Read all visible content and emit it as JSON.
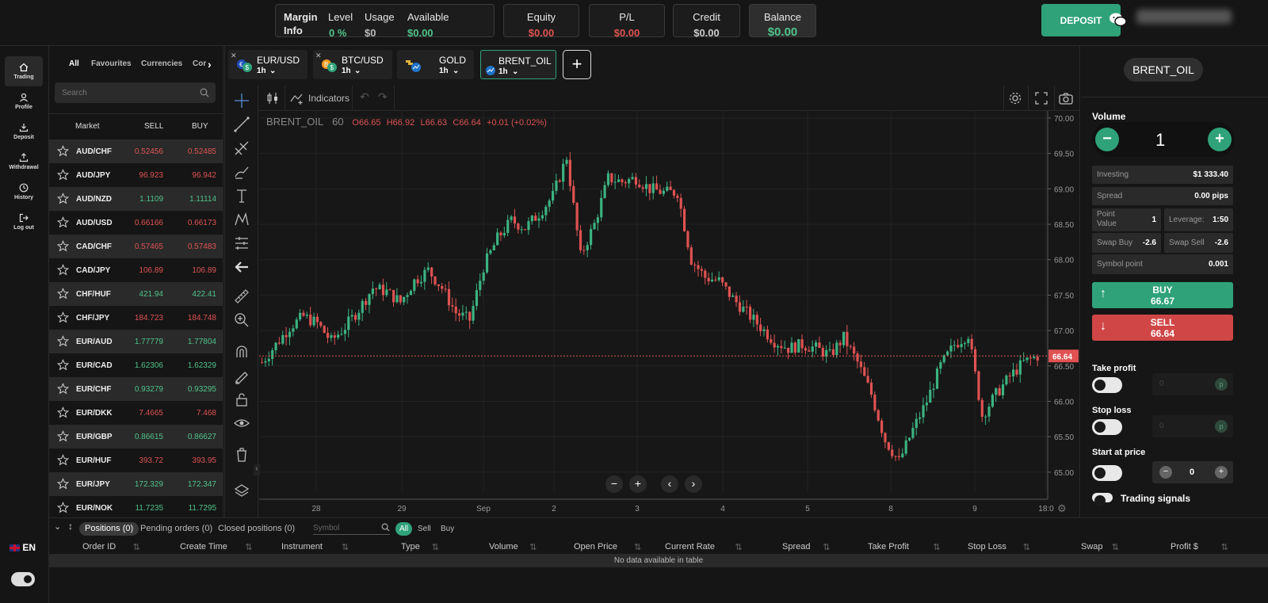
{
  "header": {
    "margin_info": {
      "title1": "Margin",
      "title2": "Info",
      "level_label": "Level",
      "level_value": "0  %",
      "usage_label": "Usage",
      "usage_value": "$0",
      "available_label": "Available",
      "available_value": "$0.00"
    },
    "metrics": [
      {
        "label": "Equity",
        "value": "$0.00",
        "color": "#e05252"
      },
      {
        "label": "P/L",
        "value": "$0.00",
        "color": "#e05252"
      },
      {
        "label": "Credit",
        "value": "$0.00",
        "color": "#cccccc"
      },
      {
        "label": "Balance",
        "value": "$0.00",
        "color": "#4fc28b"
      }
    ],
    "deposit_label": "DEPOSIT"
  },
  "rail": {
    "items": [
      {
        "label": "Trading",
        "icon": "home-icon"
      },
      {
        "label": "Profile",
        "icon": "user-icon"
      },
      {
        "label": "Deposit",
        "icon": "download-icon"
      },
      {
        "label": "Withdrawal",
        "icon": "upload-icon"
      },
      {
        "label": "History",
        "icon": "clock-icon"
      },
      {
        "label": "Log out",
        "icon": "logout-icon"
      }
    ],
    "language": "EN"
  },
  "market": {
    "tabs": [
      "All",
      "Favourites",
      "Currencies",
      "Cor"
    ],
    "search_placeholder": "Search",
    "col_market": "Market",
    "col_sell": "SELL",
    "col_buy": "BUY",
    "rows": [
      {
        "sym": "AUD/CHF",
        "sell": "0.52456",
        "buy": "0.52485",
        "c": "red"
      },
      {
        "sym": "AUD/JPY",
        "sell": "96.923",
        "buy": "96.942",
        "c": "red"
      },
      {
        "sym": "AUD/NZD",
        "sell": "1.1109",
        "buy": "1.11114",
        "c": "green"
      },
      {
        "sym": "AUD/USD",
        "sell": "0.66166",
        "buy": "0.66173",
        "c": "red"
      },
      {
        "sym": "CAD/CHF",
        "sell": "0.57465",
        "buy": "0.57483",
        "c": "red"
      },
      {
        "sym": "CAD/JPY",
        "sell": "106.89",
        "buy": "106.89",
        "c": "red"
      },
      {
        "sym": "CHF/HUF",
        "sell": "421.94",
        "buy": "422.41",
        "c": "green"
      },
      {
        "sym": "CHF/JPY",
        "sell": "184.723",
        "buy": "184.748",
        "c": "red"
      },
      {
        "sym": "EUR/AUD",
        "sell": "1.77779",
        "buy": "1.77804",
        "c": "green"
      },
      {
        "sym": "EUR/CAD",
        "sell": "1.62306",
        "buy": "1.62329",
        "c": "green"
      },
      {
        "sym": "EUR/CHF",
        "sell": "0.93279",
        "buy": "0.93295",
        "c": "green"
      },
      {
        "sym": "EUR/DKK",
        "sell": "7.4665",
        "buy": "7.468",
        "c": "red"
      },
      {
        "sym": "EUR/GBP",
        "sell": "0.86615",
        "buy": "0.86627",
        "c": "green"
      },
      {
        "sym": "EUR/HUF",
        "sell": "393.72",
        "buy": "393.95",
        "c": "red"
      },
      {
        "sym": "EUR/JPY",
        "sell": "172.329",
        "buy": "172.347",
        "c": "green"
      },
      {
        "sym": "EUR/NOK",
        "sell": "11.7235",
        "buy": "11.7295",
        "c": "green"
      }
    ]
  },
  "chart_tabs": [
    {
      "name": "EUR/USD",
      "tf": "1h",
      "icon": "euro-dollar-icon"
    },
    {
      "name": "BTC/USD",
      "tf": "1h",
      "icon": "bitcoin-icon"
    },
    {
      "name": "GOLD",
      "tf": "1h",
      "icon": "gold-icon"
    },
    {
      "name": "BRENT_OIL",
      "tf": "1h",
      "icon": "oil-icon"
    }
  ],
  "chart_toolbar": {
    "indicators_label": "Indicators"
  },
  "chart_data": {
    "type": "candlestick",
    "symbol": "BRENT_OIL",
    "interval": "60",
    "ohlc_text": {
      "o": "O66.65",
      "h": "H66.92",
      "l": "L66.63",
      "c": "C66.64",
      "chg": "+0.01 (+0.02%)"
    },
    "y_ticks": [
      "70.00",
      "69.50",
      "69.00",
      "68.50",
      "68.00",
      "67.50",
      "67.00",
      "66.50",
      "66.00",
      "65.50",
      "65.00"
    ],
    "ylim": [
      64.73,
      70.1
    ],
    "x_ticks": [
      "28",
      "29",
      "Sep",
      "2",
      "3",
      "4",
      "5",
      "8",
      "9",
      "18:0"
    ],
    "last_price": "66.64",
    "last_price_value": 66.64,
    "close_path": [
      66.55,
      66.8,
      67.05,
      67.2,
      67.1,
      66.85,
      67.05,
      67.3,
      67.6,
      67.55,
      67.4,
      67.7,
      67.85,
      67.6,
      67.25,
      67.15,
      67.9,
      68.3,
      68.55,
      68.45,
      68.65,
      68.9,
      69.45,
      68.05,
      68.5,
      69.15,
      69.1,
      69.15,
      69.0,
      68.95,
      68.95,
      68.0,
      67.75,
      67.7,
      67.45,
      67.25,
      67.05,
      66.85,
      66.75,
      66.8,
      66.75,
      66.65,
      66.9,
      66.55,
      66.1,
      65.45,
      65.15,
      65.6,
      66.0,
      66.5,
      66.8,
      66.95,
      65.8,
      66.1,
      66.35,
      66.55,
      66.64
    ]
  },
  "right_panel": {
    "symbol": "BRENT_OIL",
    "volume_label": "Volume",
    "volume_value": "1",
    "investing_k": "Investing",
    "investing_v": "$1 333.40",
    "spread_k": "Spread",
    "spread_v": "0.00 pips",
    "point_value_k": "Point Value",
    "point_value_v": "1",
    "leverage_k": "Leverage:",
    "leverage_v": "1:50",
    "swap_buy_k": "Swap Buy",
    "swap_buy_v": "-2.6",
    "swap_sell_k": "Swap Sell",
    "swap_sell_v": "-2.6",
    "symbol_point_k": "Symbol point",
    "symbol_point_v": "0.001",
    "buy_label": "BUY",
    "buy_price": "66.67",
    "sell_label": "SELL",
    "sell_price": "66.64",
    "take_profit": "Take profit",
    "stop_loss": "Stop loss",
    "start_at_price": "Start at price",
    "tp_value": "0",
    "sl_value": "0",
    "sap_value": "0",
    "trading_signals": "Trading signals",
    "buy_color": "#2fa27a",
    "sell_color": "#d04646"
  },
  "bottom": {
    "tabs": [
      "Positions (0)",
      "Pending orders (0)",
      "Closed positions (0)"
    ],
    "symbol_placeholder": "Symbol",
    "filters": [
      "All",
      "Sell",
      "Buy"
    ],
    "columns": [
      "Order ID",
      "Create Time",
      "Instrument",
      "Type",
      "Volume",
      "Open Price",
      "Current Rate",
      "Spread",
      "Take Profit",
      "Stop Loss",
      "Swap",
      "Profit $"
    ],
    "no_data": "No data available in table"
  }
}
